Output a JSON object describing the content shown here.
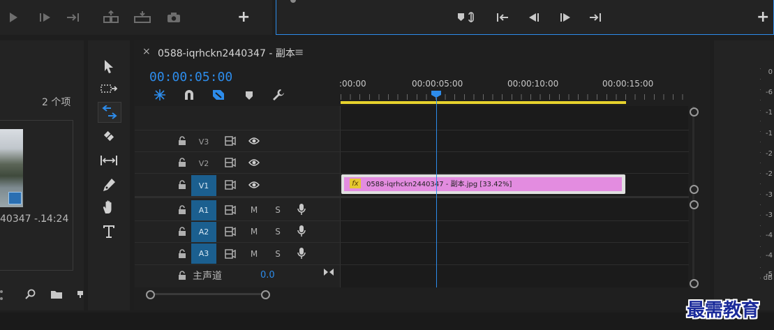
{
  "source_monitor": {
    "transport": [
      "play-icon",
      "step-forward-icon",
      "insert-icon",
      "lift-icon",
      "extract-icon",
      "camera-icon"
    ],
    "add_label": "+"
  },
  "program_monitor": {
    "add_label": "+"
  },
  "project_panel": {
    "item_count": "2 个项",
    "clip_name": "40347 -...",
    "clip_duration": "14:24"
  },
  "timeline": {
    "close_label": "×",
    "sequence_name": "0588-iqrhckn2440347 - 副本",
    "menu_label": "≡",
    "timecode": "00:00:05:00",
    "ruler": [
      ":00:00",
      "00:00:05:00",
      "00:00:10:00",
      "00:00:15:00"
    ],
    "video_tracks": [
      {
        "label": "V3",
        "active": false
      },
      {
        "label": "V2",
        "active": false
      },
      {
        "label": "V1",
        "active": true
      }
    ],
    "audio_tracks": [
      {
        "label": "A1"
      },
      {
        "label": "A2"
      },
      {
        "label": "A3"
      }
    ],
    "master": {
      "label": "主声道",
      "value": "0.0"
    },
    "clip": {
      "fx": "fx",
      "name": "0588-iqrhckn2440347 - 副本.jpg [33.42%]"
    },
    "mute_label": "M",
    "solo_label": "S"
  },
  "meter": {
    "labels": [
      "0",
      "-6",
      "-1",
      "-1",
      "-2",
      "-2",
      "-3",
      "-3",
      "-4",
      "-4",
      "-5",
      "-5",
      "dB"
    ]
  },
  "watermark": "最需教育",
  "colors": {
    "accent": "#2d8ceb",
    "clip": "#e38ce0",
    "work_area": "#e6d22d",
    "track_active": "#1b5f8f"
  }
}
